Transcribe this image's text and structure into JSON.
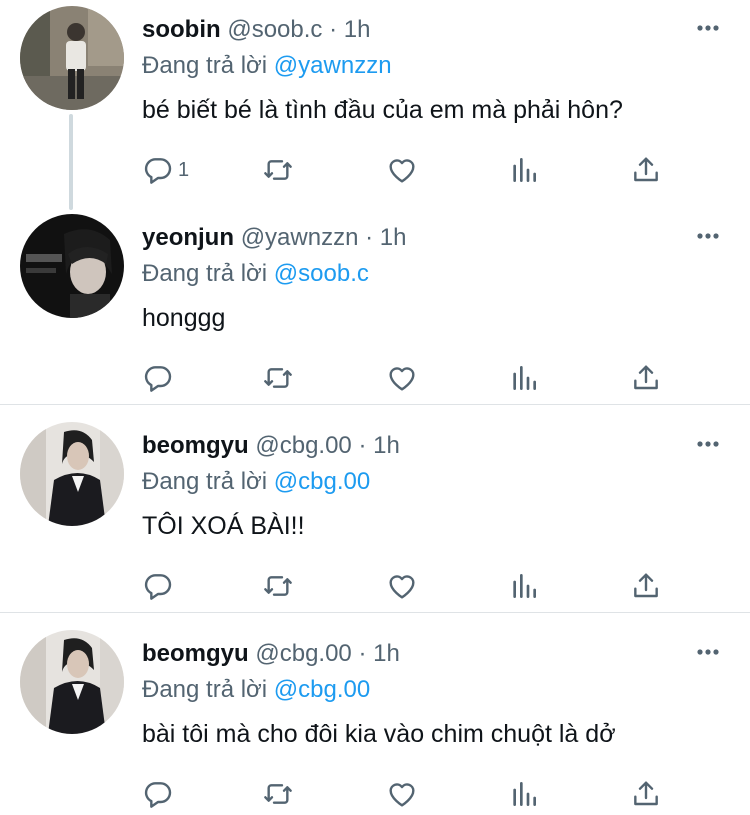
{
  "colors": {
    "link": "#1d9bf0",
    "secondary_text": "#536471",
    "primary_text": "#0f1419",
    "divider": "#dfe3e6",
    "thread_line": "#cfd9de"
  },
  "icons": {
    "reply": "reply-icon",
    "retweet": "retweet-icon",
    "like": "like-icon",
    "analytics": "analytics-icon",
    "share": "share-icon",
    "more": "more-icon"
  },
  "tweets": [
    {
      "name": "soobin",
      "handle": "@soob.c",
      "dot": "·",
      "time": "1h",
      "replying_prefix": "Đang trả lời",
      "replying_to": "@yawnzzn",
      "text": "bé biết bé là tình đầu của em mà phải hôn?",
      "reply_count": "1"
    },
    {
      "name": "yeonjun",
      "handle": "@yawnzzn",
      "dot": "·",
      "time": "1h",
      "replying_prefix": "Đang trả lời",
      "replying_to": "@soob.c",
      "text": "honggg",
      "reply_count": ""
    },
    {
      "name": "beomgyu",
      "handle": "@cbg.00",
      "dot": "·",
      "time": "1h",
      "replying_prefix": "Đang trả lời",
      "replying_to": "@cbg.00",
      "text": "TÔI XOÁ BÀI!!",
      "reply_count": ""
    },
    {
      "name": "beomgyu",
      "handle": "@cbg.00",
      "dot": "·",
      "time": "1h",
      "replying_prefix": "Đang trả lời",
      "replying_to": "@cbg.00",
      "text": "bài tôi mà cho đôi kia vào chim chuột là dở",
      "reply_count": ""
    }
  ]
}
